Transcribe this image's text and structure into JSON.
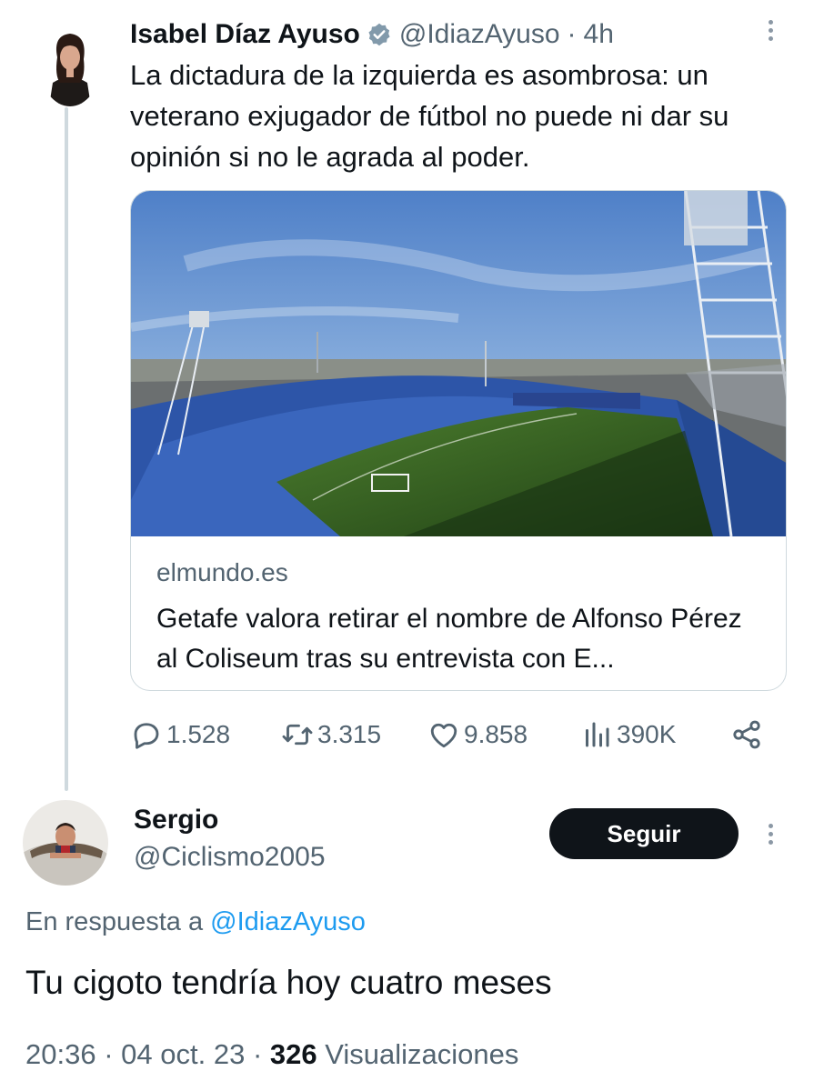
{
  "tweet": {
    "author_name": "Isabel Díaz Ayuso",
    "author_handle": "@IdiazAyuso",
    "separator": "·",
    "time": "4h",
    "text": "La dictadura de la izquierda es asombrosa: un veterano exjugador de fútbol no puede ni dar su opinión si no le agrada al poder.",
    "card": {
      "domain": "elmundo.es",
      "title": "Getafe valora retirar el nombre de Alfonso Pérez al Coliseum tras su entrevista con E..."
    },
    "stats": {
      "replies": "1.528",
      "retweets": "3.315",
      "likes": "9.858",
      "views": "390K"
    },
    "icons": [
      "verified-badge-icon",
      "more-icon",
      "reply-icon",
      "retweet-icon",
      "like-icon",
      "views-icon",
      "share-icon"
    ]
  },
  "reply": {
    "author_name": "Sergio",
    "author_handle": "@Ciclismo2005",
    "follow_label": "Seguir",
    "in_reply_to_prefix": "En respuesta a",
    "in_reply_to_handle": "@IdiazAyuso",
    "text": "Tu cigoto tendría hoy cuatro meses",
    "time": "20:36",
    "date": "04 oct. 23",
    "views_count": "326",
    "views_label": "Visualizaciones",
    "separator": "·"
  },
  "colors": {
    "text": "#0f1419",
    "muted": "#536471",
    "link": "#1d9bf0",
    "verified": "#829aab",
    "border": "#cfd9de"
  }
}
